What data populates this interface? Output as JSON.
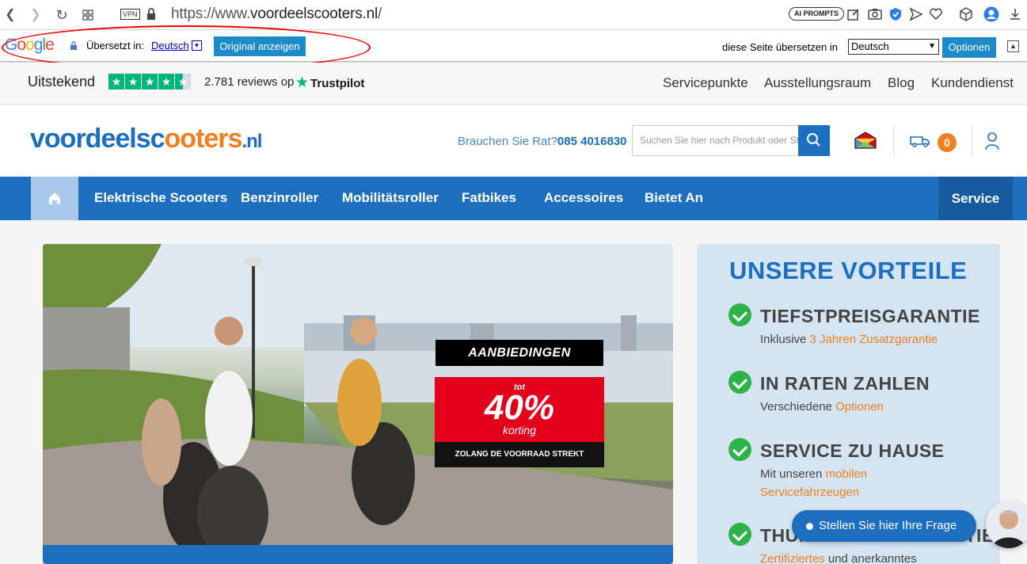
{
  "browser": {
    "url_prefix": "https://www.",
    "url_domain": "voordeelscooters.nl",
    "url_suffix": "/",
    "vpn_label": "VPN",
    "ai_prompts_label": "AI PROMPTS"
  },
  "translate_bar": {
    "logo_letters": [
      "G",
      "o",
      "o",
      "g",
      "l",
      "e"
    ],
    "translated_in_label": "Übersetzt in:",
    "language_link": "Deutsch",
    "show_original_button": "Original anzeigen",
    "translate_page_label": "diese Seite übersetzen in",
    "selected_language": "Deutsch",
    "options_button": "Optionen"
  },
  "topbar": {
    "rating_word": "Uitstekend",
    "stars": 4.5,
    "reviews_text": "2.781 reviews op",
    "trustpilot": "Trustpilot",
    "links": [
      "Servicepunkte",
      "Ausstellungsraum",
      "Blog",
      "Kundendienst"
    ]
  },
  "header": {
    "logo_part1": "voordeelsc",
    "logo_part2": "ooters",
    "logo_tld": ".nl",
    "help_text": "Brauchen Sie Rat?",
    "phone": "085 4016830",
    "search_placeholder": "Suchen Sie hier nach Produkt oder St",
    "cart_count": "0"
  },
  "nav": {
    "items": [
      "Elektrische Scooters",
      "Benzinroller",
      "Mobilitätsroller",
      "Fatbikes",
      "Accessoires",
      "Bietet An"
    ],
    "service": "Service"
  },
  "hero": {
    "deal_title": "AANBIEDINGEN",
    "deal_tot": "tot",
    "deal_percent": "40%",
    "deal_korting": "korting",
    "deal_sub": "ZOLANG DE VOORRAAD STREKT"
  },
  "advantages": {
    "title": "UNSERE VORTEILE",
    "items": [
      {
        "heading": "TIEFSTPREISGARANTIE",
        "text": "Inklusive ",
        "link": "3 Jahren Zusatzgarantie"
      },
      {
        "heading": "IN RATEN ZAHLEN",
        "text": "Verschiedene ",
        "link": "Optionen"
      },
      {
        "heading": "SERVICE ZU HAUSE",
        "text": "Mit unseren ",
        "link": "mobilen Servicefahrzeugen"
      },
      {
        "heading": "THUISWINKEL GARANTIE",
        "link": "Zertifiziertes",
        "text_after": " und anerkanntes"
      }
    ]
  },
  "chat": {
    "label": "Stellen Sie hier Ihre Frage"
  },
  "colors": {
    "brand_blue": "#1c6fbf",
    "brand_orange": "#f07f21",
    "trustpilot_green": "#00b67a",
    "check_green": "#2eb34a",
    "deal_red": "#e3001b"
  }
}
